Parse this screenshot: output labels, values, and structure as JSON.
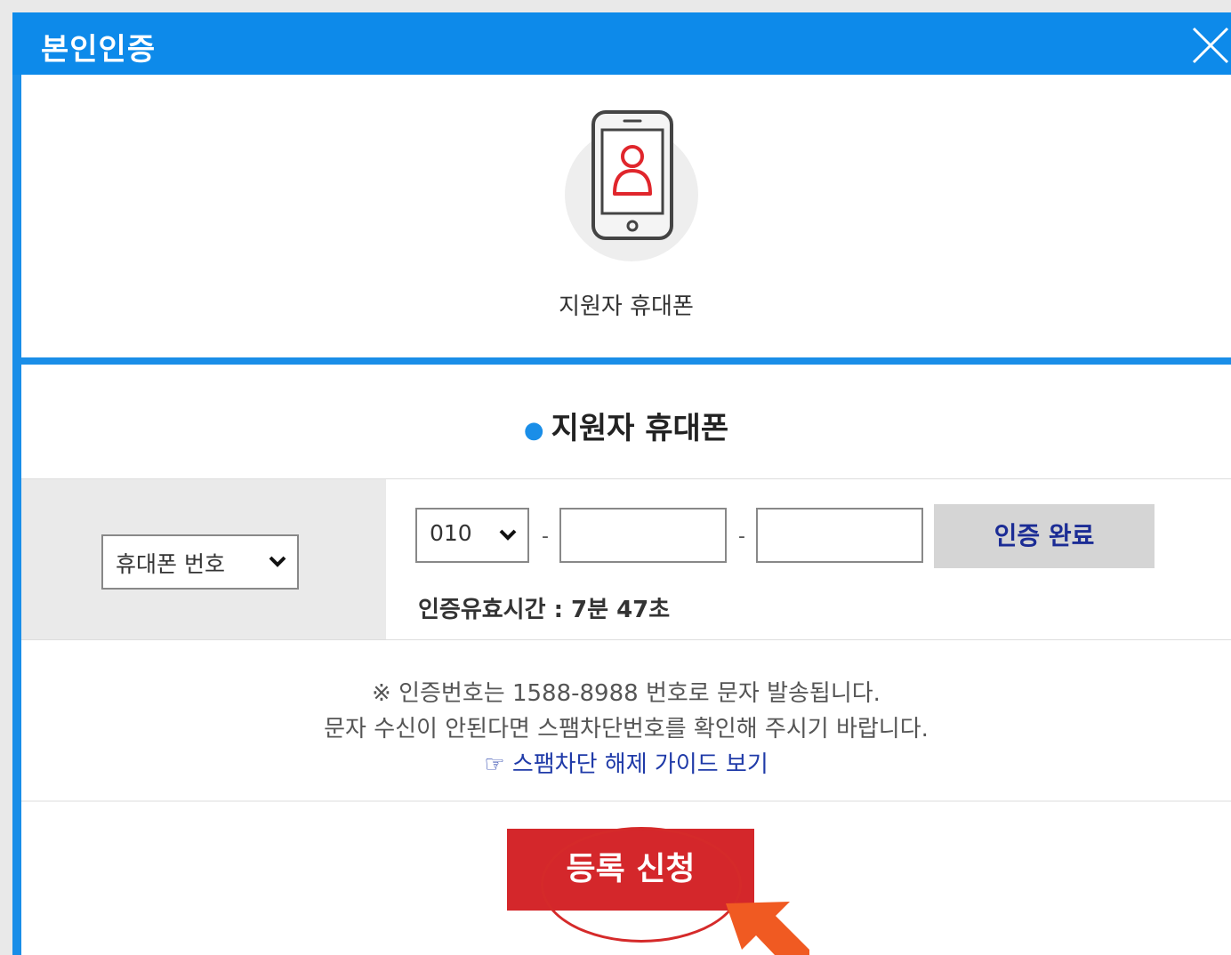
{
  "dialog": {
    "title": "본인인증",
    "close_icon": "close-icon"
  },
  "method": {
    "icon": "phone-user-icon",
    "label": "지원자 휴대폰"
  },
  "section": {
    "title": "지원자 휴대폰"
  },
  "form": {
    "type_select_value": "휴대폰 번호",
    "prefix_value": "010",
    "dash": "-",
    "middle_value": "",
    "last_value": "",
    "confirm_label": "인증 완료",
    "timer_text": "인증유효시간 : 7분 47초"
  },
  "notice": {
    "line1": "※ 인증번호는 1588-8988 번호로 문자 발송됩니다.",
    "line2": "문자 수신이 안된다면 스팸차단번호를 확인해 주시기 바랍니다.",
    "guide_link": "☞ 스팸차단 해제 가이드 보기"
  },
  "submit": {
    "label": "등록 신청"
  },
  "colors": {
    "accent": "#0d8aea",
    "submit": "#d4272b",
    "link": "#1f3aa8",
    "highlight": "#d52a2a",
    "arrow": "#f05a22"
  }
}
